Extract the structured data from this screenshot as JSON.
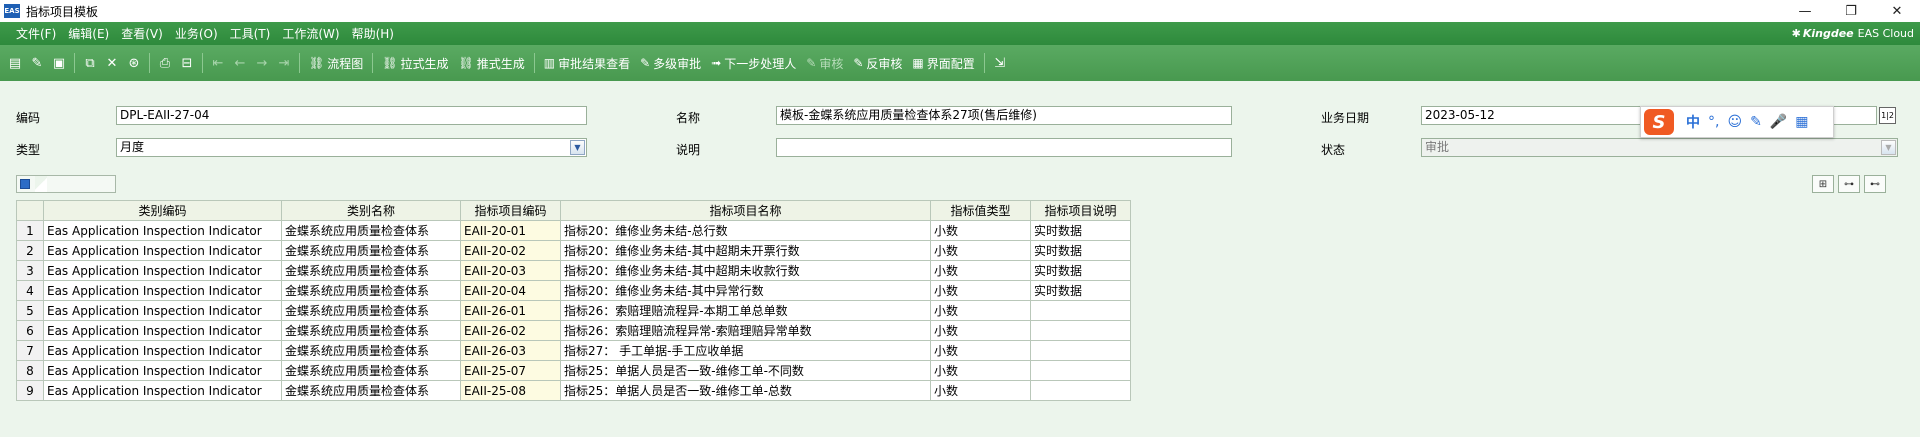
{
  "window": {
    "app_logo": "EAS",
    "title": "指标项目模板",
    "controls": {
      "minimize": "—",
      "maximize": "❐",
      "close": "✕"
    }
  },
  "menu": {
    "items": [
      "文件(F)",
      "编辑(E)",
      "查看(V)",
      "业务(O)",
      "工具(T)",
      "工作流(W)",
      "帮助(H)"
    ],
    "brand": {
      "name": "Kingdee",
      "product": "EAS Cloud"
    }
  },
  "toolbar": {
    "buttons": [
      {
        "name": "flowchart",
        "label": "流程图"
      },
      {
        "name": "pull-generate",
        "label": "拉式生成"
      },
      {
        "name": "push-generate",
        "label": "推式生成"
      },
      {
        "name": "view-approval-result",
        "label": "审批结果查看"
      },
      {
        "name": "multi-level-approval",
        "label": "多级审批"
      },
      {
        "name": "next-step-handler",
        "label": "下一步处理人"
      },
      {
        "name": "audit",
        "label": "审核"
      },
      {
        "name": "unaudit",
        "label": "反审核"
      },
      {
        "name": "interface-config",
        "label": "界面配置"
      }
    ]
  },
  "form": {
    "code_label": "编码",
    "code_value": "DPL-EAII-27-04",
    "name_label": "名称",
    "name_value": "模板-金蝶系统应用质量检查体系27项(售后维修)",
    "bizdate_label": "业务日期",
    "bizdate_value": "2023-05-12",
    "type_label": "类型",
    "type_value": "月度",
    "desc_label": "说明",
    "desc_value": "",
    "status_label": "状态",
    "status_value": "审批"
  },
  "ime": {
    "logo": "S",
    "items": [
      "中",
      "°,",
      "☺",
      "✎",
      "🎤",
      "▦"
    ]
  },
  "table": {
    "columns": [
      "类别编码",
      "类别名称",
      "指标项目编码",
      "指标项目名称",
      "指标值类型",
      "指标项目说明"
    ],
    "rows": [
      {
        "n": "1",
        "cat_code": "Eas Application Inspection Indicator",
        "cat_name": "金蝶系统应用质量检查体系",
        "item_code": "EAII-20-01",
        "item_name": "指标20：维修业务未结-总行数",
        "value_type": "小数",
        "desc": "实时数据"
      },
      {
        "n": "2",
        "cat_code": "Eas Application Inspection Indicator",
        "cat_name": "金蝶系统应用质量检查体系",
        "item_code": "EAII-20-02",
        "item_name": "指标20：维修业务未结-其中超期未开票行数",
        "value_type": "小数",
        "desc": "实时数据"
      },
      {
        "n": "3",
        "cat_code": "Eas Application Inspection Indicator",
        "cat_name": "金蝶系统应用质量检查体系",
        "item_code": "EAII-20-03",
        "item_name": "指标20：维修业务未结-其中超期未收款行数",
        "value_type": "小数",
        "desc": "实时数据"
      },
      {
        "n": "4",
        "cat_code": "Eas Application Inspection Indicator",
        "cat_name": "金蝶系统应用质量检查体系",
        "item_code": "EAII-20-04",
        "item_name": "指标20：维修业务未结-其中异常行数",
        "value_type": "小数",
        "desc": "实时数据"
      },
      {
        "n": "5",
        "cat_code": "Eas Application Inspection Indicator",
        "cat_name": "金蝶系统应用质量检查体系",
        "item_code": "EAII-26-01",
        "item_name": "指标26：索赔理赔流程异-本期工单总单数",
        "value_type": "小数",
        "desc": ""
      },
      {
        "n": "6",
        "cat_code": "Eas Application Inspection Indicator",
        "cat_name": "金蝶系统应用质量检查体系",
        "item_code": "EAII-26-02",
        "item_name": "指标26：索赔理赔流程异常-索赔理赔异常单数",
        "value_type": "小数",
        "desc": ""
      },
      {
        "n": "7",
        "cat_code": "Eas Application Inspection Indicator",
        "cat_name": "金蝶系统应用质量检查体系",
        "item_code": "EAII-26-03",
        "item_name": "指标27： 手工单据-手工应收单据",
        "value_type": "小数",
        "desc": ""
      },
      {
        "n": "8",
        "cat_code": "Eas Application Inspection Indicator",
        "cat_name": "金蝶系统应用质量检查体系",
        "item_code": "EAII-25-07",
        "item_name": "指标25：单据人员是否一致-维修工单-不同数",
        "value_type": "小数",
        "desc": ""
      },
      {
        "n": "9",
        "cat_code": "Eas Application Inspection Indicator",
        "cat_name": "金蝶系统应用质量检查体系",
        "item_code": "EAII-25-08",
        "item_name": "指标25：单据人员是否一致-维修工单-总数",
        "value_type": "小数",
        "desc": ""
      }
    ]
  }
}
